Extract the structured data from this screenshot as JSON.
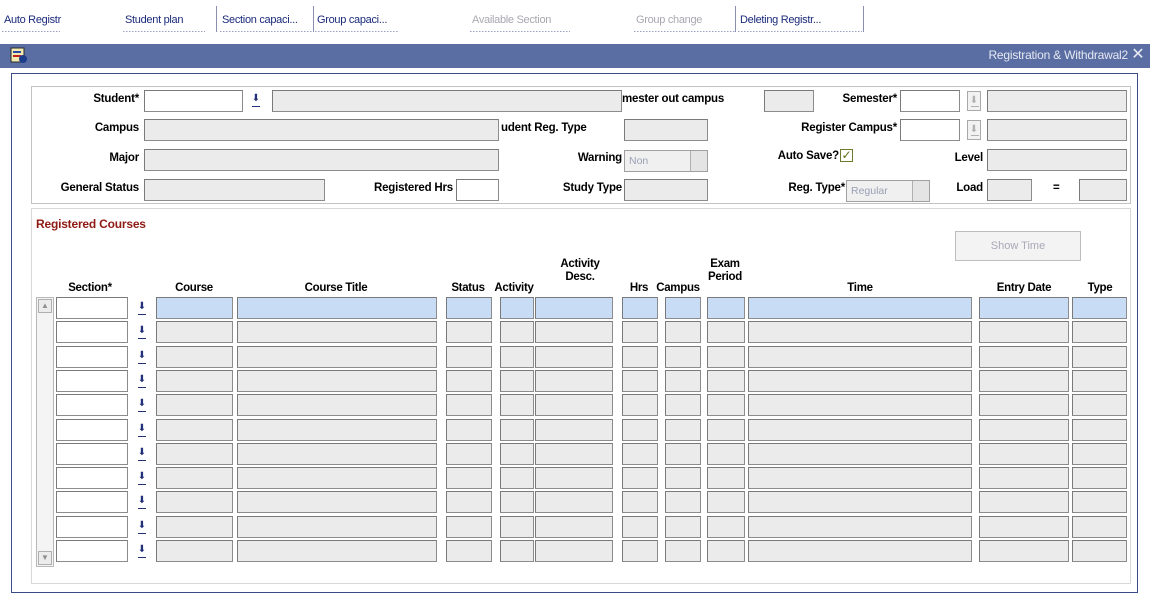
{
  "tabs": [
    {
      "label": "Auto Registr",
      "enabled": true
    },
    {
      "label": "Student plan",
      "enabled": true
    },
    {
      "label": "Section capaci...",
      "enabled": true
    },
    {
      "label": "Group capaci...",
      "enabled": true
    },
    {
      "label": "Available Section",
      "enabled": false
    },
    {
      "label": "Group change",
      "enabled": false
    },
    {
      "label": "Deleting Registr...",
      "enabled": true
    }
  ],
  "window": {
    "title": "Registration & Withdrawal2",
    "app_icon": "document-icon",
    "close_icon": "close-icon"
  },
  "header": {
    "student_label": "Student*",
    "student_value": "",
    "student_name": "",
    "semester_out_campus_label": "mester out campus",
    "semester_out_campus_value": "",
    "semester_label": "Semester*",
    "semester_value": "",
    "semester_desc": "",
    "campus_label": "Campus",
    "campus_value": "",
    "student_reg_type_label": "udent Reg. Type",
    "student_reg_type_value": "",
    "register_campus_label": "Register Campus*",
    "register_campus_value": "",
    "register_campus_desc": "",
    "major_label": "Major",
    "major_value": "",
    "warning_label": "Warning",
    "warning_value": "Non",
    "auto_save_label": "Auto Save?",
    "auto_save_checked": true,
    "level_label": "Level",
    "level_value": "",
    "general_status_label": "General Status",
    "general_status_value": "",
    "registered_hrs_label": "Registered Hrs",
    "registered_hrs_value": "",
    "study_type_label": "Study Type",
    "study_type_value": "",
    "reg_type_label": "Reg. Type*",
    "reg_type_value": "Regular",
    "load_label": "Load",
    "load_value": "",
    "load_sep": "=",
    "load_total": ""
  },
  "courses": {
    "section_title": "Registered Courses",
    "show_time_label": "Show Time",
    "columns": {
      "section": "Section*",
      "course": "Course",
      "course_title": "Course Title",
      "status": "Status",
      "activity": "Activity",
      "activity_desc": "Activity Desc.",
      "hrs": "Hrs",
      "campus": "Campus",
      "exam_period": "Exam Period",
      "time": "Time",
      "entry_date": "Entry Date",
      "type": "Type"
    },
    "row_count": 11,
    "colors": {
      "selected_row": "#c8dcf5",
      "field": "#ebebeb"
    }
  }
}
